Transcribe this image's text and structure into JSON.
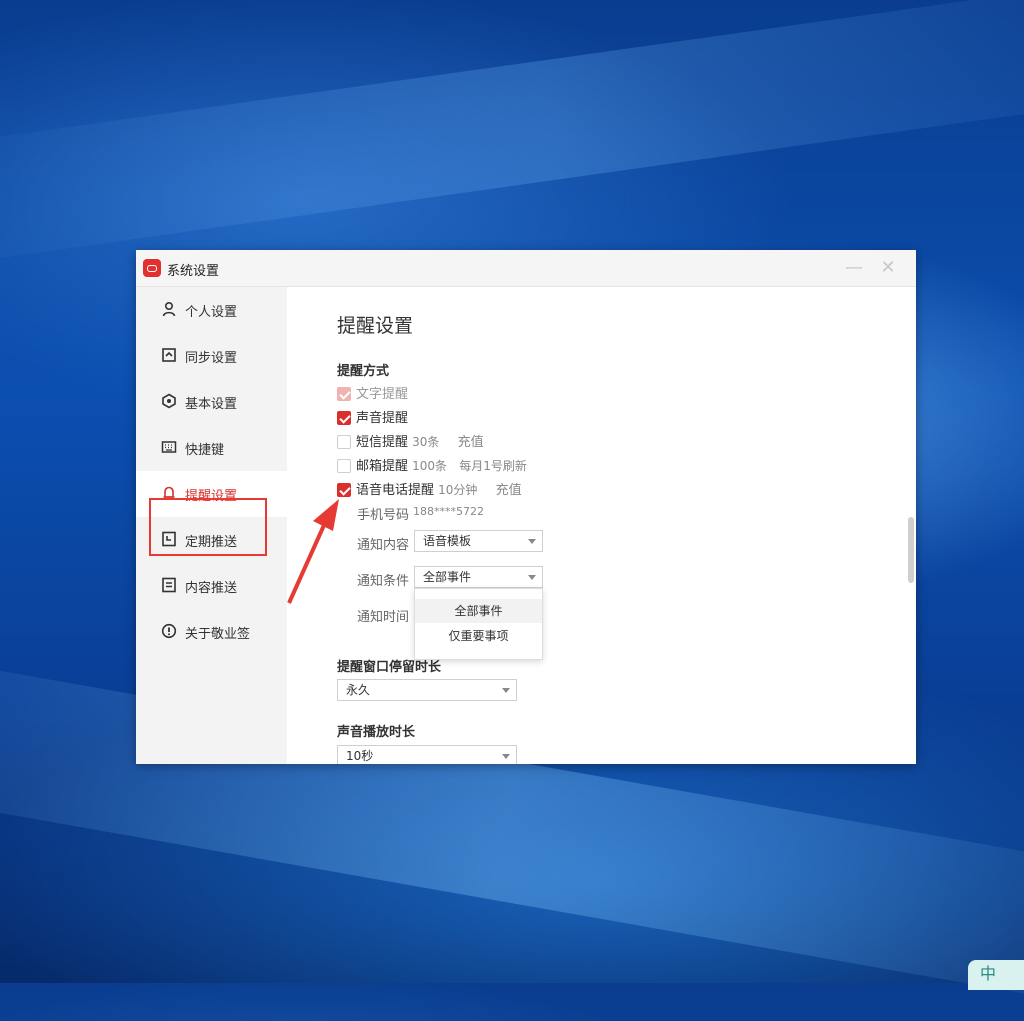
{
  "window": {
    "title": "系统设置",
    "minimize_glyph": "—",
    "close_glyph": "✕"
  },
  "sidebar": {
    "items": [
      {
        "label": "个人设置",
        "icon": "person-icon"
      },
      {
        "label": "同步设置",
        "icon": "sync-icon"
      },
      {
        "label": "基本设置",
        "icon": "settings-icon"
      },
      {
        "label": "快捷键",
        "icon": "keyboard-icon"
      },
      {
        "label": "提醒设置",
        "icon": "bell-icon",
        "active": true
      },
      {
        "label": "定期推送",
        "icon": "clock-doc-icon"
      },
      {
        "label": "内容推送",
        "icon": "doc-icon"
      },
      {
        "label": "关于敬业签",
        "icon": "info-icon"
      }
    ]
  },
  "content": {
    "page_title": "提醒设置",
    "section_method": "提醒方式",
    "opt_text": "文字提醒",
    "opt_sound": "声音提醒",
    "opt_sms": "短信提醒",
    "sms_count": "30条",
    "sms_recharge": "充值",
    "opt_email": "邮箱提醒",
    "email_count": "100条",
    "email_refresh": "每月1号刷新",
    "opt_voice": "语音电话提醒",
    "voice_minutes": "10分钟",
    "voice_recharge": "充值",
    "phone_label": "手机号码",
    "phone_value": "188****5722",
    "notify_content_label": "通知内容",
    "notify_content_value": "语音模板",
    "notify_condition_label": "通知条件",
    "notify_condition_value": "全部事件",
    "notify_time_label": "通知时间",
    "dropdown_options": [
      "全部事件",
      "仅重要事项"
    ],
    "section_window": "提醒窗口停留时长",
    "window_value": "永久",
    "section_sound": "声音播放时长",
    "sound_value": "10秒"
  },
  "colors": {
    "accent": "#d9302b",
    "annotation": "#e63a35"
  },
  "taskbar": {
    "ime_text": "中"
  }
}
